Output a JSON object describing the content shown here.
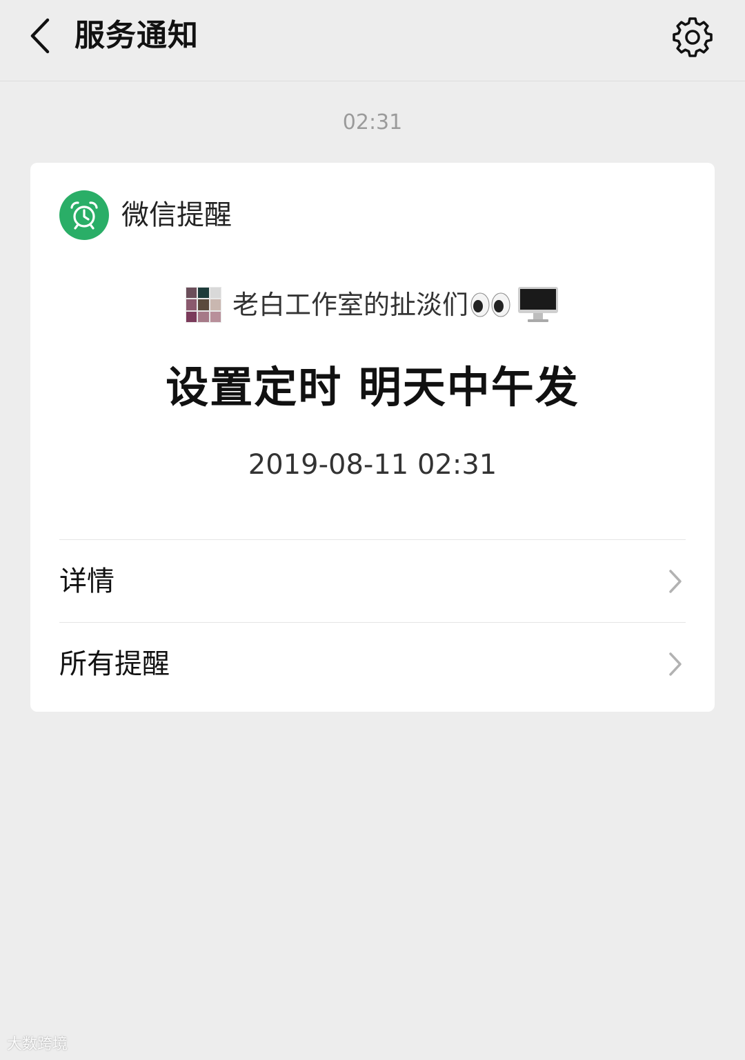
{
  "header": {
    "title": "服务通知",
    "back_icon": "chevron-left-icon",
    "settings_icon": "gear-icon"
  },
  "time_separator": "02:31",
  "card": {
    "source": {
      "icon": "alarm-clock-icon",
      "name": "微信提醒",
      "icon_color": "#2aae67"
    },
    "group": {
      "avatar_icon": "group-avatar-grid",
      "name": "老白工作室的扯淡们",
      "trailing_emojis": [
        "eyes-emoji",
        "desktop-computer-emoji"
      ]
    },
    "message_title": "设置定时 明天中午发",
    "message_time": "2019-08-11 02:31",
    "rows": [
      {
        "label": "详情",
        "icon": "chevron-right-icon"
      },
      {
        "label": "所有提醒",
        "icon": "chevron-right-icon"
      }
    ]
  },
  "watermark": "大数跨境"
}
